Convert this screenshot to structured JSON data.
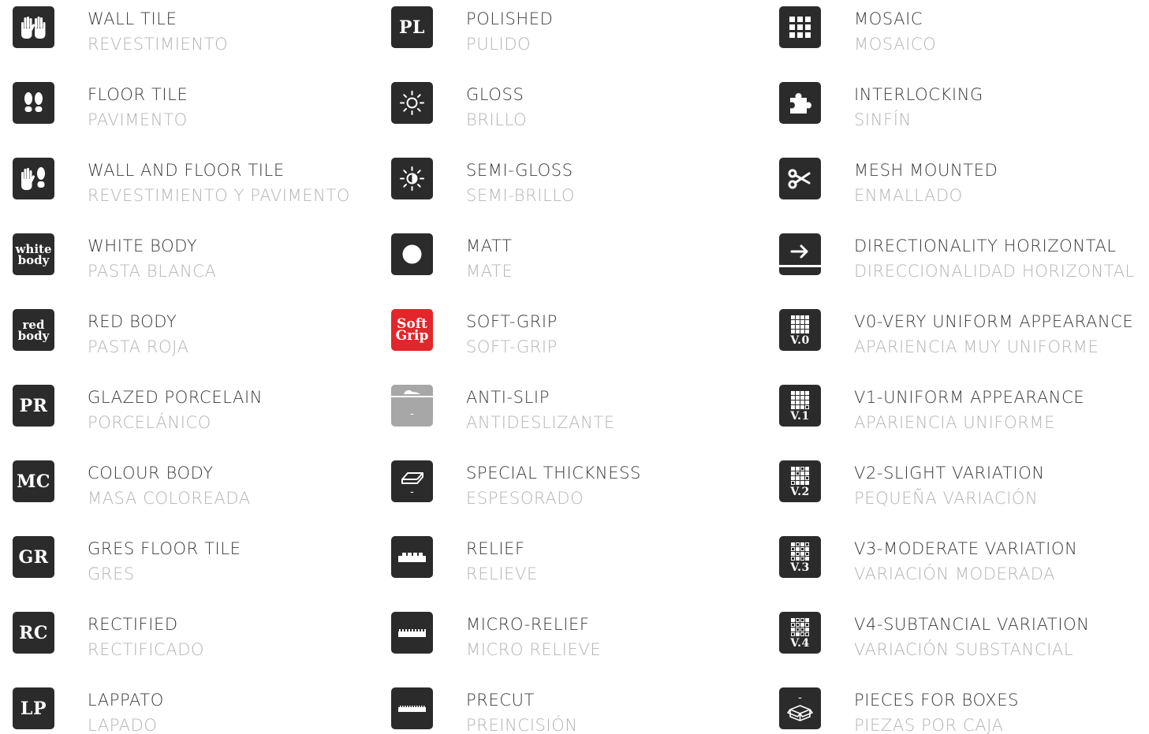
{
  "columns": [
    {
      "items": [
        {
          "en": "WALL TILE",
          "es": "REVESTIMIENTO",
          "icon": "hands-icon"
        },
        {
          "en": "FLOOR TILE",
          "es": "PAVIMENTO",
          "icon": "footprints-icon"
        },
        {
          "en": "WALL AND FLOOR TILE",
          "es": "REVESTIMIENTO Y PAVIMENTO",
          "icon": "hand-and-foot-icon"
        },
        {
          "en": "WHITE BODY",
          "es": "PASTA BLANCA",
          "icon": "white-body-icon",
          "icon_text_1": "white",
          "icon_text_2": "body"
        },
        {
          "en": "RED BODY",
          "es": "PASTA ROJA",
          "icon": "red-body-icon",
          "icon_text_1": "red",
          "icon_text_2": "body"
        },
        {
          "en": "GLAZED PORCELAIN",
          "es": "PORCELÁNICO",
          "icon": "pr-icon",
          "icon_text": "PR"
        },
        {
          "en": "COLOUR BODY",
          "es": "MASA COLOREADA",
          "icon": "mc-icon",
          "icon_text": "MC"
        },
        {
          "en": "GRES FLOOR TILE",
          "es": "GRES",
          "icon": "gr-icon",
          "icon_text": "GR"
        },
        {
          "en": "RECTIFIED",
          "es": "RECTIFICADO",
          "icon": "rc-icon",
          "icon_text": "RC"
        },
        {
          "en": "LAPPATO",
          "es": "LAPADO",
          "icon": "lp-icon",
          "icon_text": "LP"
        }
      ]
    },
    {
      "items": [
        {
          "en": "POLISHED",
          "es": "PULIDO",
          "icon": "pl-icon",
          "icon_text": "PL"
        },
        {
          "en": "GLOSS",
          "es": "BRILLO",
          "icon": "sun-icon"
        },
        {
          "en": "SEMI-GLOSS",
          "es": "SEMI-BRILLO",
          "icon": "half-sun-icon"
        },
        {
          "en": "MATT",
          "es": "MATE",
          "icon": "dot-icon"
        },
        {
          "en": "SOFT-GRIP",
          "es": "SOFT-GRIP",
          "icon": "soft-grip-icon",
          "icon_text_1": "Soft",
          "icon_text_2": "Grip",
          "color": "#e2262b"
        },
        {
          "en": "ANTI-SLIP",
          "es": "ANTIDESLIZANTE",
          "icon": "shoe-icon",
          "icon_text": "-",
          "color": "#a7a7a7"
        },
        {
          "en": "SPECIAL THICKNESS",
          "es": "ESPESORADO",
          "icon": "slab-icon",
          "icon_text": "-"
        },
        {
          "en": "RELIEF",
          "es": "RELIEVE",
          "icon": "relief-icon"
        },
        {
          "en": "MICRO-RELIEF",
          "es": "MICRO RELIEVE",
          "icon": "micro-relief-icon"
        },
        {
          "en": "PRECUT",
          "es": "PREINCISIÓN",
          "icon": "precut-icon"
        }
      ]
    },
    {
      "items": [
        {
          "en": "MOSAIC",
          "es": "MOSAICO",
          "icon": "grid-icon"
        },
        {
          "en": "INTERLOCKING",
          "es": "SINFÍN",
          "icon": "puzzle-icon"
        },
        {
          "en": "MESH MOUNTED",
          "es": "ENMALLADO",
          "icon": "scissors-icon"
        },
        {
          "en": "DIRECTIONALITY HORIZONTAL",
          "es": "DIRECCIONALIDAD HORIZONTAL",
          "icon": "arrow-right-icon"
        },
        {
          "en": "V0-VERY UNIFORM APPEARANCE",
          "es": "APARIENCIA MUY UNIFORME",
          "icon": "v0-icon",
          "icon_text": "V.0"
        },
        {
          "en": "V1-UNIFORM APPEARANCE",
          "es": "APARIENCIA UNIFORME",
          "icon": "v1-icon",
          "icon_text": "V.1"
        },
        {
          "en": "V2-SLIGHT VARIATION",
          "es": "PEQUEÑA VARIACIÓN",
          "icon": "v2-icon",
          "icon_text": "V.2"
        },
        {
          "en": "V3-MODERATE VARIATION",
          "es": "VARIACIÓN MODERADA",
          "icon": "v3-icon",
          "icon_text": "V.3"
        },
        {
          "en": "V4-SUBTANCIAL VARIATION",
          "es": "VARIACIÓN SUBSTANCIAL",
          "icon": "v4-icon",
          "icon_text": "V.4"
        },
        {
          "en": "PIECES FOR BOXES",
          "es": "PIEZAS POR CAJA",
          "icon": "box-icon",
          "icon_text": "-"
        }
      ]
    }
  ],
  "colors": {
    "icon_bg": "#2b2b2b",
    "english_text": "#3a3a3a",
    "spanish_text": "#b4b4b4"
  }
}
